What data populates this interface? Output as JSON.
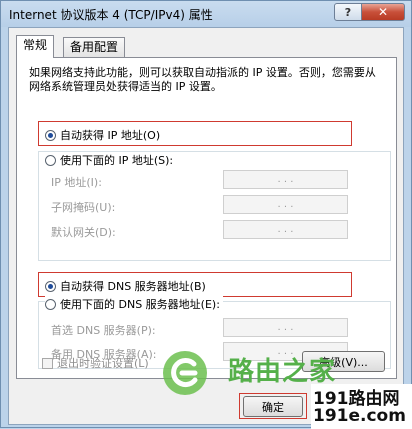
{
  "window": {
    "title": "Internet 协议版本 4 (TCP/IPv4) 属性",
    "help_label": "?",
    "close_label": "✕"
  },
  "tabs": [
    {
      "label": "常规",
      "active": true
    },
    {
      "label": "备用配置",
      "active": false
    }
  ],
  "description": "如果网络支持此功能，则可以获取自动指派的 IP 设置。否则，您需要从网络系统管理员处获得适当的 IP 设置。",
  "ip_section": {
    "auto_label": "自动获得 IP 地址(O)",
    "auto_selected": true,
    "manual_label": "使用下面的 IP 地址(S):",
    "fields": [
      {
        "label": "IP 地址(I):",
        "value": ". . ."
      },
      {
        "label": "子网掩码(U):",
        "value": ". . ."
      },
      {
        "label": "默认网关(D):",
        "value": ". . ."
      }
    ]
  },
  "dns_section": {
    "auto_label": "自动获得 DNS 服务器地址(B)",
    "auto_selected": true,
    "manual_label": "使用下面的 DNS 服务器地址(E):",
    "fields": [
      {
        "label": "首选 DNS 服务器(P):",
        "value": ". . ."
      },
      {
        "label": "备用 DNS 服务器(A):",
        "value": ". . ."
      }
    ]
  },
  "validate_label": "退出时验证设置(L)",
  "advanced_label": "高级(V)...",
  "ok_label": "确定",
  "logo": {
    "text": "路由之家",
    "icon": "router-home-logo-icon"
  },
  "watermark": {
    "line1": "191路由网",
    "line2": "191e.com"
  },
  "colors": {
    "highlight": "#cf3a30",
    "logo_green": "#55b04a"
  }
}
